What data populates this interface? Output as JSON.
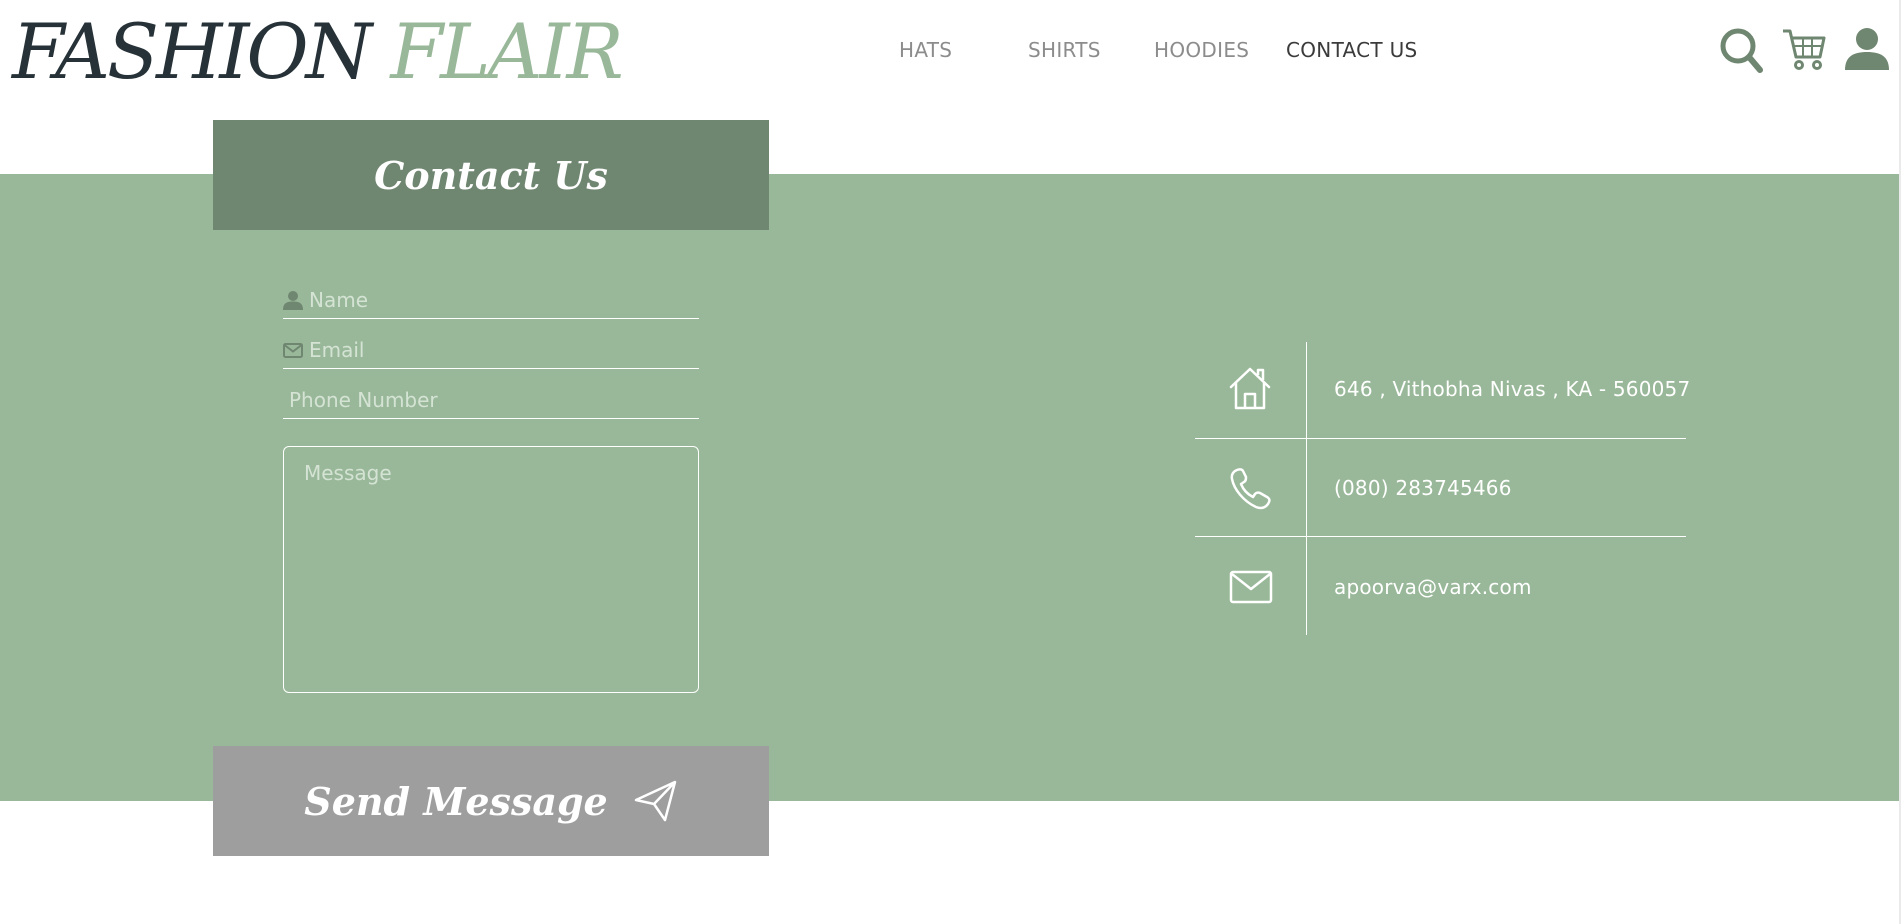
{
  "brand": {
    "part1": "FASHION",
    "part2": "FLAIR"
  },
  "nav": {
    "items": [
      "HATS",
      "SHIRTS",
      "HOODIES",
      "CONTACT US"
    ],
    "active": "CONTACT US"
  },
  "header_icons": [
    "search-icon",
    "cart-icon",
    "user-icon"
  ],
  "contact": {
    "heading": "Contact Us",
    "form": {
      "name_placeholder": "Name",
      "email_placeholder": "Email",
      "phone_placeholder": "Phone Number",
      "message_placeholder": "Message",
      "submit_label": "Send Message"
    },
    "info": {
      "address": "646 , Vithobha Nivas , KA - 560057",
      "phone": "(080) 283745466",
      "email": "apoorva@varx.com"
    }
  },
  "colors": {
    "brand_dark": "#263238",
    "brand_green": "#99b899",
    "band_green": "#99b899",
    "card_header": "#6f8670",
    "button_grey": "#9e9e9e",
    "icon_green": "#6f8670"
  }
}
